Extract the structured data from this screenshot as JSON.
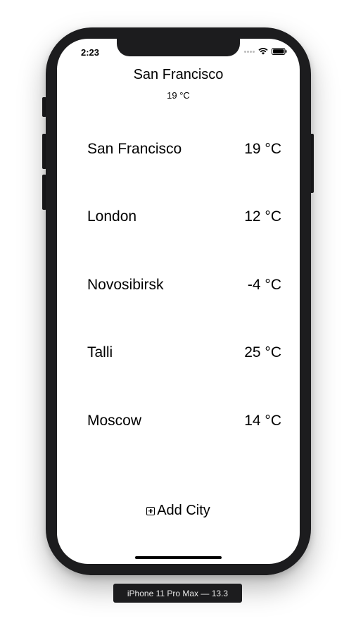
{
  "status_bar": {
    "time": "2:23"
  },
  "header": {
    "city": "San Francisco",
    "temperature": "19 °C"
  },
  "cities": [
    {
      "name": "San Francisco",
      "temperature": "19 °C"
    },
    {
      "name": "London",
      "temperature": "12 °C"
    },
    {
      "name": "Novosibirsk",
      "temperature": "-4 °C"
    },
    {
      "name": "Talli",
      "temperature": "25 °C"
    },
    {
      "name": "Moscow",
      "temperature": "14 °C"
    }
  ],
  "add_city": {
    "label": "Add City",
    "icon": "plus-square-icon"
  },
  "device_label": "iPhone 11 Pro Max — 13.3",
  "colors": {
    "device_frame": "#1c1c1e",
    "text": "#000000",
    "screen_background": "#ffffff"
  }
}
